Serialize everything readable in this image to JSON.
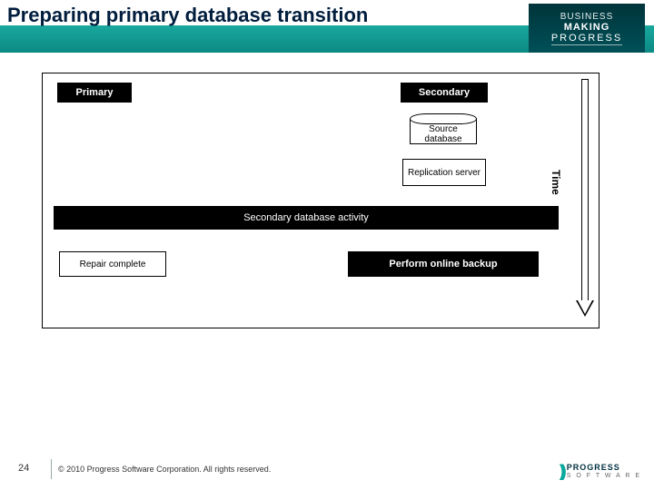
{
  "title": "Preparing primary database transition",
  "corp_tag": {
    "l1": "BUSINESS",
    "l2": "MAKING",
    "l3": "PROGRESS"
  },
  "diagram": {
    "primary_label": "Primary",
    "secondary_label": "Secondary",
    "source_db_label": "Source database",
    "replication_label": "Replication server",
    "sec_activity_label": "Secondary database activity",
    "repair_label": "Repair complete",
    "backup_label": "Perform online backup",
    "time_label": "Time"
  },
  "footer": {
    "page": "24",
    "copyright": "© 2010 Progress Software Corporation. All rights reserved.",
    "logo_brand": "PROGRESS",
    "logo_sub": "S O F T W A R E"
  }
}
